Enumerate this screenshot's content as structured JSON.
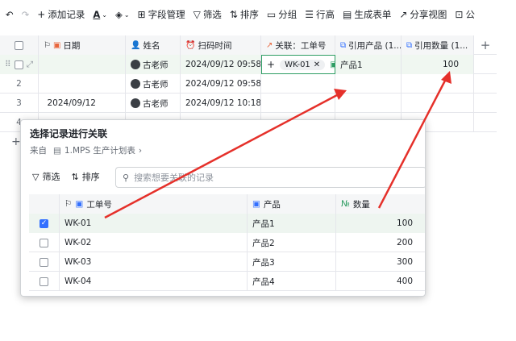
{
  "toolbar": {
    "items": [
      {
        "label": "添加记录"
      },
      {
        "label": "字段管理"
      },
      {
        "label": "筛选"
      },
      {
        "label": "排序"
      },
      {
        "label": "分组"
      },
      {
        "label": "行高"
      },
      {
        "label": "生成表单"
      },
      {
        "label": "分享视图"
      },
      {
        "label": "公"
      }
    ]
  },
  "grid": {
    "columns": [
      "日期",
      "姓名",
      "扫码时间",
      "关联：工单号",
      "引用产品 (1...",
      "引用数量 (1..."
    ],
    "rows": [
      {
        "num": "",
        "date": "",
        "name": "古老师",
        "time": "2024/09/12 09:58",
        "link": "WK-01",
        "product": "产品1",
        "qty": "100"
      },
      {
        "num": "2",
        "date": "",
        "name": "古老师",
        "time": "2024/09/12 09:58",
        "link": "",
        "product": "",
        "qty": ""
      },
      {
        "num": "3",
        "date": "2024/09/12",
        "name": "古老师",
        "time": "2024/09/12 10:18",
        "link": "",
        "product": "",
        "qty": ""
      },
      {
        "num": "4",
        "date": "",
        "name": "",
        "time": "",
        "link": "",
        "product": "",
        "qty": ""
      }
    ]
  },
  "dialog": {
    "title": "选择记录进行关联",
    "source_prefix": "来自",
    "source_table": "1.MPS 生产计划表",
    "filter_label": "筛选",
    "sort_label": "排序",
    "search_placeholder": "搜索想要关联的记录",
    "columns": [
      "工单号",
      "产品",
      "数量"
    ],
    "rows": [
      {
        "id": "WK-01",
        "product": "产品1",
        "qty": "100",
        "checked": true
      },
      {
        "id": "WK-02",
        "product": "产品2",
        "qty": "200",
        "checked": false
      },
      {
        "id": "WK-03",
        "product": "产品3",
        "qty": "300",
        "checked": false
      },
      {
        "id": "WK-04",
        "product": "产品4",
        "qty": "400",
        "checked": false
      }
    ]
  },
  "colors": {
    "accent": "#3370ff",
    "arrow": "#e5302a",
    "selected_row": "#eef5f0",
    "link_border": "#2e9d63"
  }
}
